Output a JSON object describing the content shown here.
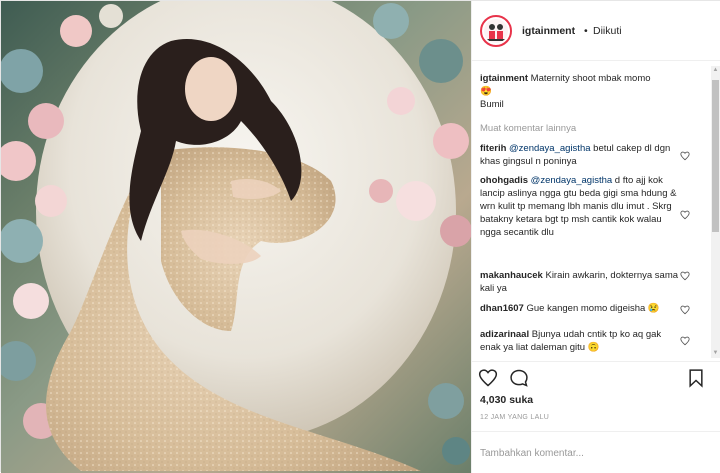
{
  "post": {
    "username": "igtainment",
    "separator": "•",
    "follow_status": "Diikuti",
    "caption_text": "Maternity shoot mbak momo",
    "caption_emoji": "😍",
    "caption_line2": "Bumil",
    "more_comments": "Muat komentar lainnya",
    "likes": "4,030 suka",
    "time": "12 JAM YANG LALU",
    "comment_placeholder": "Tambahkan komentar..."
  },
  "comments": [
    {
      "user": "fiterih",
      "mention": "@zendaya_agistha",
      "text": " betul cakep dl dgn khas gingsul n poninya"
    },
    {
      "user": "ohohgadis",
      "mention": "@zendaya_agistha",
      "text": " d fto ajj kok lancip aslinya ngga gtu beda gigi sma hdung & wrn kulit tp memang lbh manis dlu imut . Skrg batakny ketara bgt tp msh cantik kok walau ngga secantik dlu"
    },
    {
      "user": "makanhaucek",
      "text": " Kirain awkarin, dokternya sama kali ya"
    },
    {
      "user": "dhan1607",
      "text": " Gue kangen momo digeisha 😢"
    },
    {
      "user": "adizarinaal",
      "text": " Bjunya udah cntik tp ko aq gak enak ya liat daleman gitu 🙃"
    }
  ],
  "icons": {
    "avatar": "igtainment-logo-icon",
    "like": "heart-icon",
    "comment": "comment-bubble-icon",
    "save": "bookmark-icon",
    "comment_like": "small-heart-icon"
  },
  "colors": {
    "username": "#262626",
    "mention": "#003569",
    "muted": "#999999",
    "avatar_ring": "#e8334a"
  }
}
